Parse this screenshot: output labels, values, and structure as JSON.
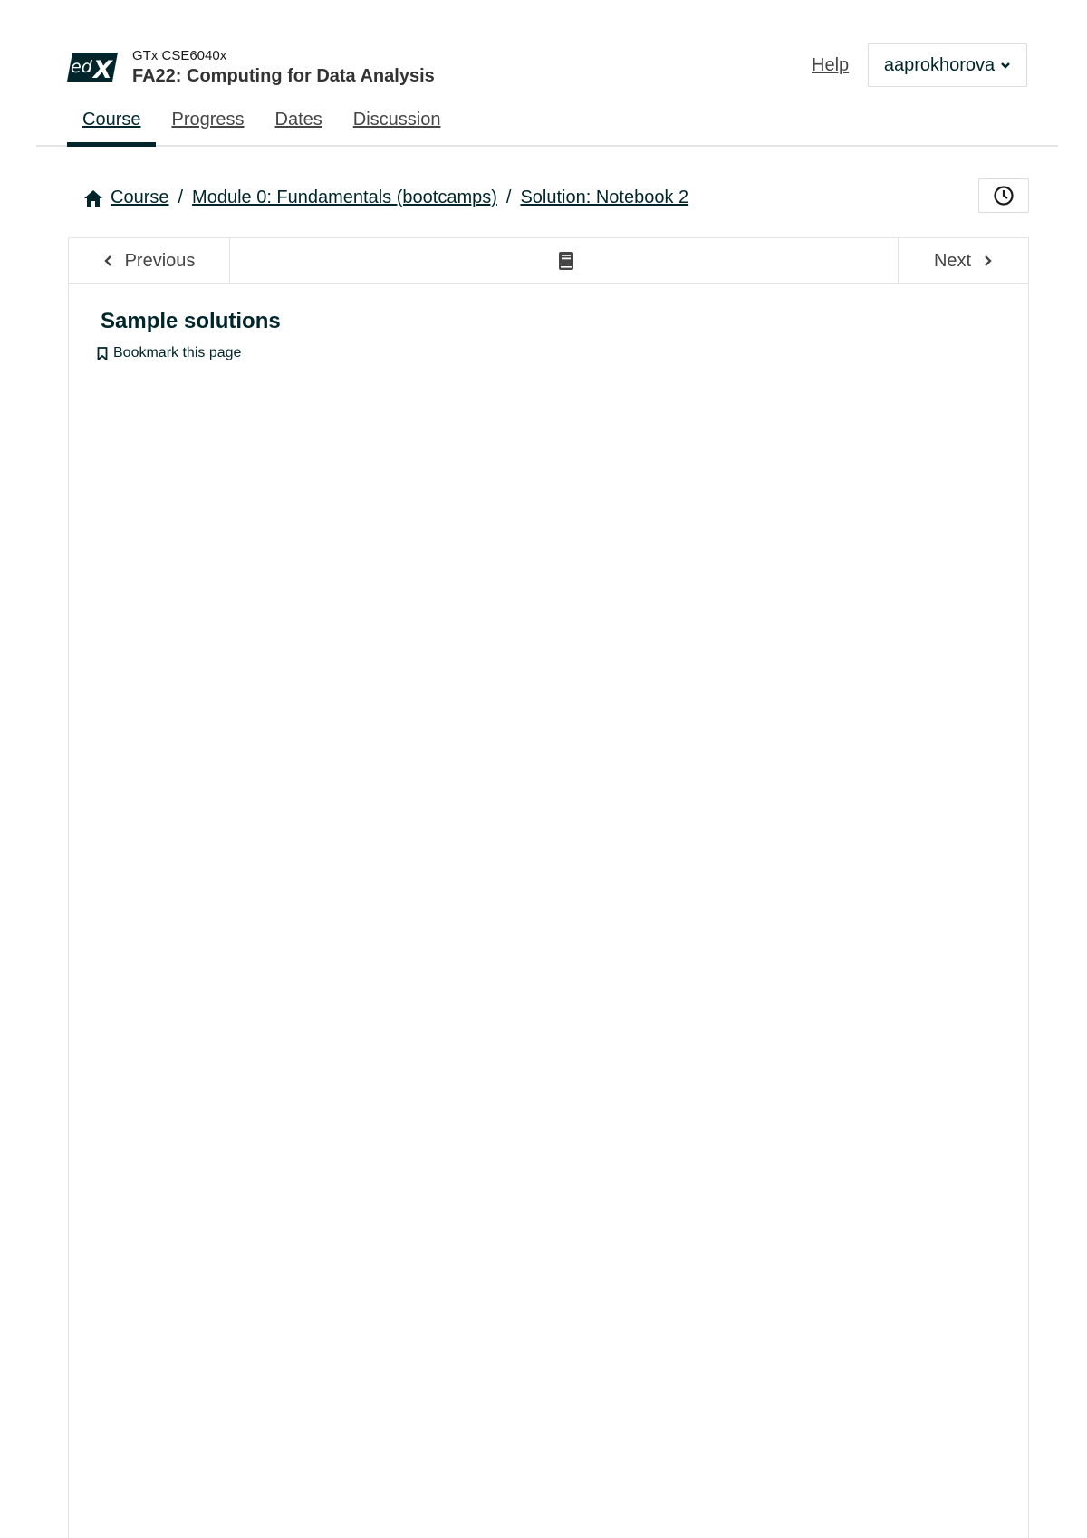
{
  "brand": {
    "logo_text": "edX",
    "color": "#00262b"
  },
  "header": {
    "course_org": "GTx CSE6040x",
    "course_title": "FA22: Computing for Data Analysis",
    "help_label": "Help",
    "username": "aaprokhorova"
  },
  "tabs": [
    {
      "label": "Course",
      "active": true
    },
    {
      "label": "Progress",
      "active": false
    },
    {
      "label": "Dates",
      "active": false
    },
    {
      "label": "Discussion",
      "active": false
    }
  ],
  "breadcrumb": {
    "items": [
      "Course",
      "Module 0: Fundamentals (bootcamps)",
      "Solution: Notebook 2"
    ],
    "separator": "/"
  },
  "sequence_nav": {
    "previous_label": "Previous",
    "next_label": "Next"
  },
  "unit": {
    "title": "Sample solutions",
    "bookmark_label": "Bookmark this page"
  },
  "icons": {
    "home": "home-icon",
    "history": "history-icon",
    "unit": "book-icon",
    "bookmark": "bookmark-icon",
    "prev": "chevron-left-icon",
    "next": "chevron-right-icon",
    "dropdown": "chevron-down-icon"
  }
}
